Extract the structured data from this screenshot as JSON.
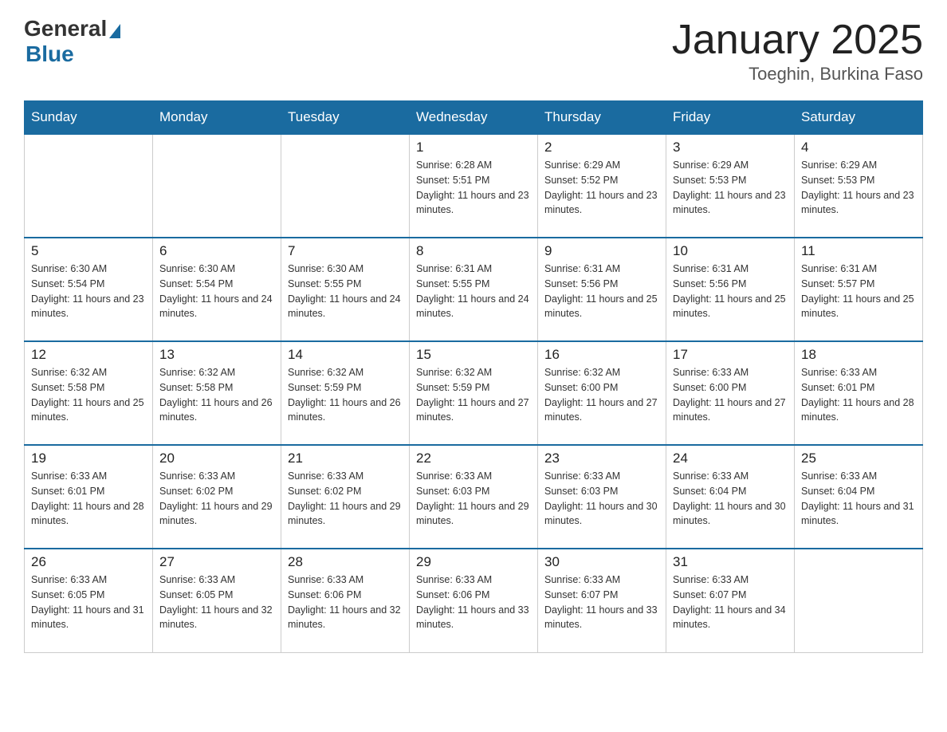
{
  "logo": {
    "general": "General",
    "blue": "Blue"
  },
  "header": {
    "title": "January 2025",
    "location": "Toeghin, Burkina Faso"
  },
  "days_of_week": [
    "Sunday",
    "Monday",
    "Tuesday",
    "Wednesday",
    "Thursday",
    "Friday",
    "Saturday"
  ],
  "weeks": [
    [
      {
        "day": "",
        "sunrise": "",
        "sunset": "",
        "daylight": ""
      },
      {
        "day": "",
        "sunrise": "",
        "sunset": "",
        "daylight": ""
      },
      {
        "day": "",
        "sunrise": "",
        "sunset": "",
        "daylight": ""
      },
      {
        "day": "1",
        "sunrise": "Sunrise: 6:28 AM",
        "sunset": "Sunset: 5:51 PM",
        "daylight": "Daylight: 11 hours and 23 minutes."
      },
      {
        "day": "2",
        "sunrise": "Sunrise: 6:29 AM",
        "sunset": "Sunset: 5:52 PM",
        "daylight": "Daylight: 11 hours and 23 minutes."
      },
      {
        "day": "3",
        "sunrise": "Sunrise: 6:29 AM",
        "sunset": "Sunset: 5:53 PM",
        "daylight": "Daylight: 11 hours and 23 minutes."
      },
      {
        "day": "4",
        "sunrise": "Sunrise: 6:29 AM",
        "sunset": "Sunset: 5:53 PM",
        "daylight": "Daylight: 11 hours and 23 minutes."
      }
    ],
    [
      {
        "day": "5",
        "sunrise": "Sunrise: 6:30 AM",
        "sunset": "Sunset: 5:54 PM",
        "daylight": "Daylight: 11 hours and 23 minutes."
      },
      {
        "day": "6",
        "sunrise": "Sunrise: 6:30 AM",
        "sunset": "Sunset: 5:54 PM",
        "daylight": "Daylight: 11 hours and 24 minutes."
      },
      {
        "day": "7",
        "sunrise": "Sunrise: 6:30 AM",
        "sunset": "Sunset: 5:55 PM",
        "daylight": "Daylight: 11 hours and 24 minutes."
      },
      {
        "day": "8",
        "sunrise": "Sunrise: 6:31 AM",
        "sunset": "Sunset: 5:55 PM",
        "daylight": "Daylight: 11 hours and 24 minutes."
      },
      {
        "day": "9",
        "sunrise": "Sunrise: 6:31 AM",
        "sunset": "Sunset: 5:56 PM",
        "daylight": "Daylight: 11 hours and 25 minutes."
      },
      {
        "day": "10",
        "sunrise": "Sunrise: 6:31 AM",
        "sunset": "Sunset: 5:56 PM",
        "daylight": "Daylight: 11 hours and 25 minutes."
      },
      {
        "day": "11",
        "sunrise": "Sunrise: 6:31 AM",
        "sunset": "Sunset: 5:57 PM",
        "daylight": "Daylight: 11 hours and 25 minutes."
      }
    ],
    [
      {
        "day": "12",
        "sunrise": "Sunrise: 6:32 AM",
        "sunset": "Sunset: 5:58 PM",
        "daylight": "Daylight: 11 hours and 25 minutes."
      },
      {
        "day": "13",
        "sunrise": "Sunrise: 6:32 AM",
        "sunset": "Sunset: 5:58 PM",
        "daylight": "Daylight: 11 hours and 26 minutes."
      },
      {
        "day": "14",
        "sunrise": "Sunrise: 6:32 AM",
        "sunset": "Sunset: 5:59 PM",
        "daylight": "Daylight: 11 hours and 26 minutes."
      },
      {
        "day": "15",
        "sunrise": "Sunrise: 6:32 AM",
        "sunset": "Sunset: 5:59 PM",
        "daylight": "Daylight: 11 hours and 27 minutes."
      },
      {
        "day": "16",
        "sunrise": "Sunrise: 6:32 AM",
        "sunset": "Sunset: 6:00 PM",
        "daylight": "Daylight: 11 hours and 27 minutes."
      },
      {
        "day": "17",
        "sunrise": "Sunrise: 6:33 AM",
        "sunset": "Sunset: 6:00 PM",
        "daylight": "Daylight: 11 hours and 27 minutes."
      },
      {
        "day": "18",
        "sunrise": "Sunrise: 6:33 AM",
        "sunset": "Sunset: 6:01 PM",
        "daylight": "Daylight: 11 hours and 28 minutes."
      }
    ],
    [
      {
        "day": "19",
        "sunrise": "Sunrise: 6:33 AM",
        "sunset": "Sunset: 6:01 PM",
        "daylight": "Daylight: 11 hours and 28 minutes."
      },
      {
        "day": "20",
        "sunrise": "Sunrise: 6:33 AM",
        "sunset": "Sunset: 6:02 PM",
        "daylight": "Daylight: 11 hours and 29 minutes."
      },
      {
        "day": "21",
        "sunrise": "Sunrise: 6:33 AM",
        "sunset": "Sunset: 6:02 PM",
        "daylight": "Daylight: 11 hours and 29 minutes."
      },
      {
        "day": "22",
        "sunrise": "Sunrise: 6:33 AM",
        "sunset": "Sunset: 6:03 PM",
        "daylight": "Daylight: 11 hours and 29 minutes."
      },
      {
        "day": "23",
        "sunrise": "Sunrise: 6:33 AM",
        "sunset": "Sunset: 6:03 PM",
        "daylight": "Daylight: 11 hours and 30 minutes."
      },
      {
        "day": "24",
        "sunrise": "Sunrise: 6:33 AM",
        "sunset": "Sunset: 6:04 PM",
        "daylight": "Daylight: 11 hours and 30 minutes."
      },
      {
        "day": "25",
        "sunrise": "Sunrise: 6:33 AM",
        "sunset": "Sunset: 6:04 PM",
        "daylight": "Daylight: 11 hours and 31 minutes."
      }
    ],
    [
      {
        "day": "26",
        "sunrise": "Sunrise: 6:33 AM",
        "sunset": "Sunset: 6:05 PM",
        "daylight": "Daylight: 11 hours and 31 minutes."
      },
      {
        "day": "27",
        "sunrise": "Sunrise: 6:33 AM",
        "sunset": "Sunset: 6:05 PM",
        "daylight": "Daylight: 11 hours and 32 minutes."
      },
      {
        "day": "28",
        "sunrise": "Sunrise: 6:33 AM",
        "sunset": "Sunset: 6:06 PM",
        "daylight": "Daylight: 11 hours and 32 minutes."
      },
      {
        "day": "29",
        "sunrise": "Sunrise: 6:33 AM",
        "sunset": "Sunset: 6:06 PM",
        "daylight": "Daylight: 11 hours and 33 minutes."
      },
      {
        "day": "30",
        "sunrise": "Sunrise: 6:33 AM",
        "sunset": "Sunset: 6:07 PM",
        "daylight": "Daylight: 11 hours and 33 minutes."
      },
      {
        "day": "31",
        "sunrise": "Sunrise: 6:33 AM",
        "sunset": "Sunset: 6:07 PM",
        "daylight": "Daylight: 11 hours and 34 minutes."
      },
      {
        "day": "",
        "sunrise": "",
        "sunset": "",
        "daylight": ""
      }
    ]
  ]
}
